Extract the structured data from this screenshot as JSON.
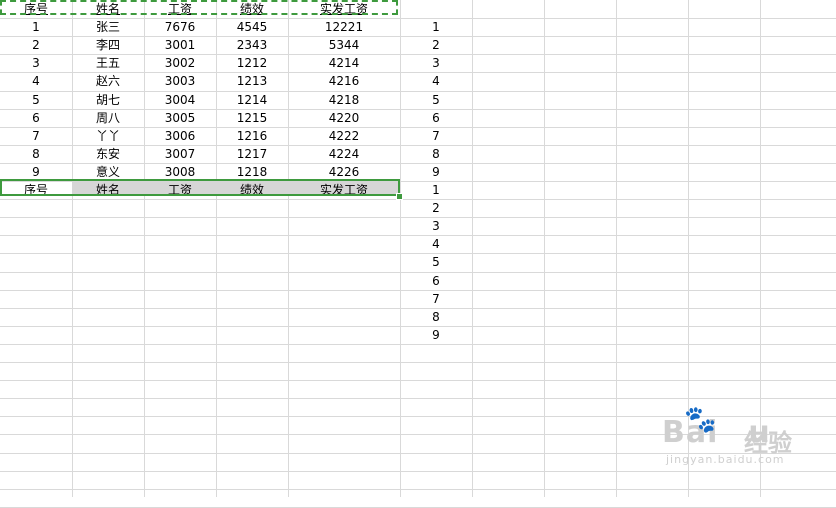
{
  "header": [
    "序号",
    "姓名",
    "工资",
    "绩效",
    "实发工资"
  ],
  "rows": [
    [
      "1",
      "张三",
      "7676",
      "4545",
      "12221"
    ],
    [
      "2",
      "李四",
      "3001",
      "2343",
      "5344"
    ],
    [
      "3",
      "王五",
      "3002",
      "1212",
      "4214"
    ],
    [
      "4",
      "赵六",
      "3003",
      "1213",
      "4216"
    ],
    [
      "5",
      "胡七",
      "3004",
      "1214",
      "4218"
    ],
    [
      "6",
      "周八",
      "3005",
      "1215",
      "4220"
    ],
    [
      "7",
      "丫丫",
      "3006",
      "1216",
      "4222"
    ],
    [
      "8",
      "东安",
      "3007",
      "1217",
      "4224"
    ],
    [
      "9",
      "意义",
      "3008",
      "1218",
      "4226"
    ]
  ],
  "pasted_header": [
    "序号",
    "姓名",
    "工资",
    "绩效",
    "实发工资"
  ],
  "side_numbers": [
    "1",
    "2",
    "3",
    "4",
    "5",
    "6",
    "7",
    "8",
    "9",
    "1",
    "2",
    "3",
    "4",
    "5",
    "6",
    "7",
    "8",
    "9"
  ],
  "watermark": {
    "brand": "Bai",
    "paw": "🐾",
    "brand_end": "u",
    "brand_cn": "经验",
    "url": "jingyan.baidu.com"
  },
  "colors": {
    "selection_border": "#3e9a3e",
    "selection_fill": "#d6d6d6",
    "gridline": "#d9d9d9"
  }
}
